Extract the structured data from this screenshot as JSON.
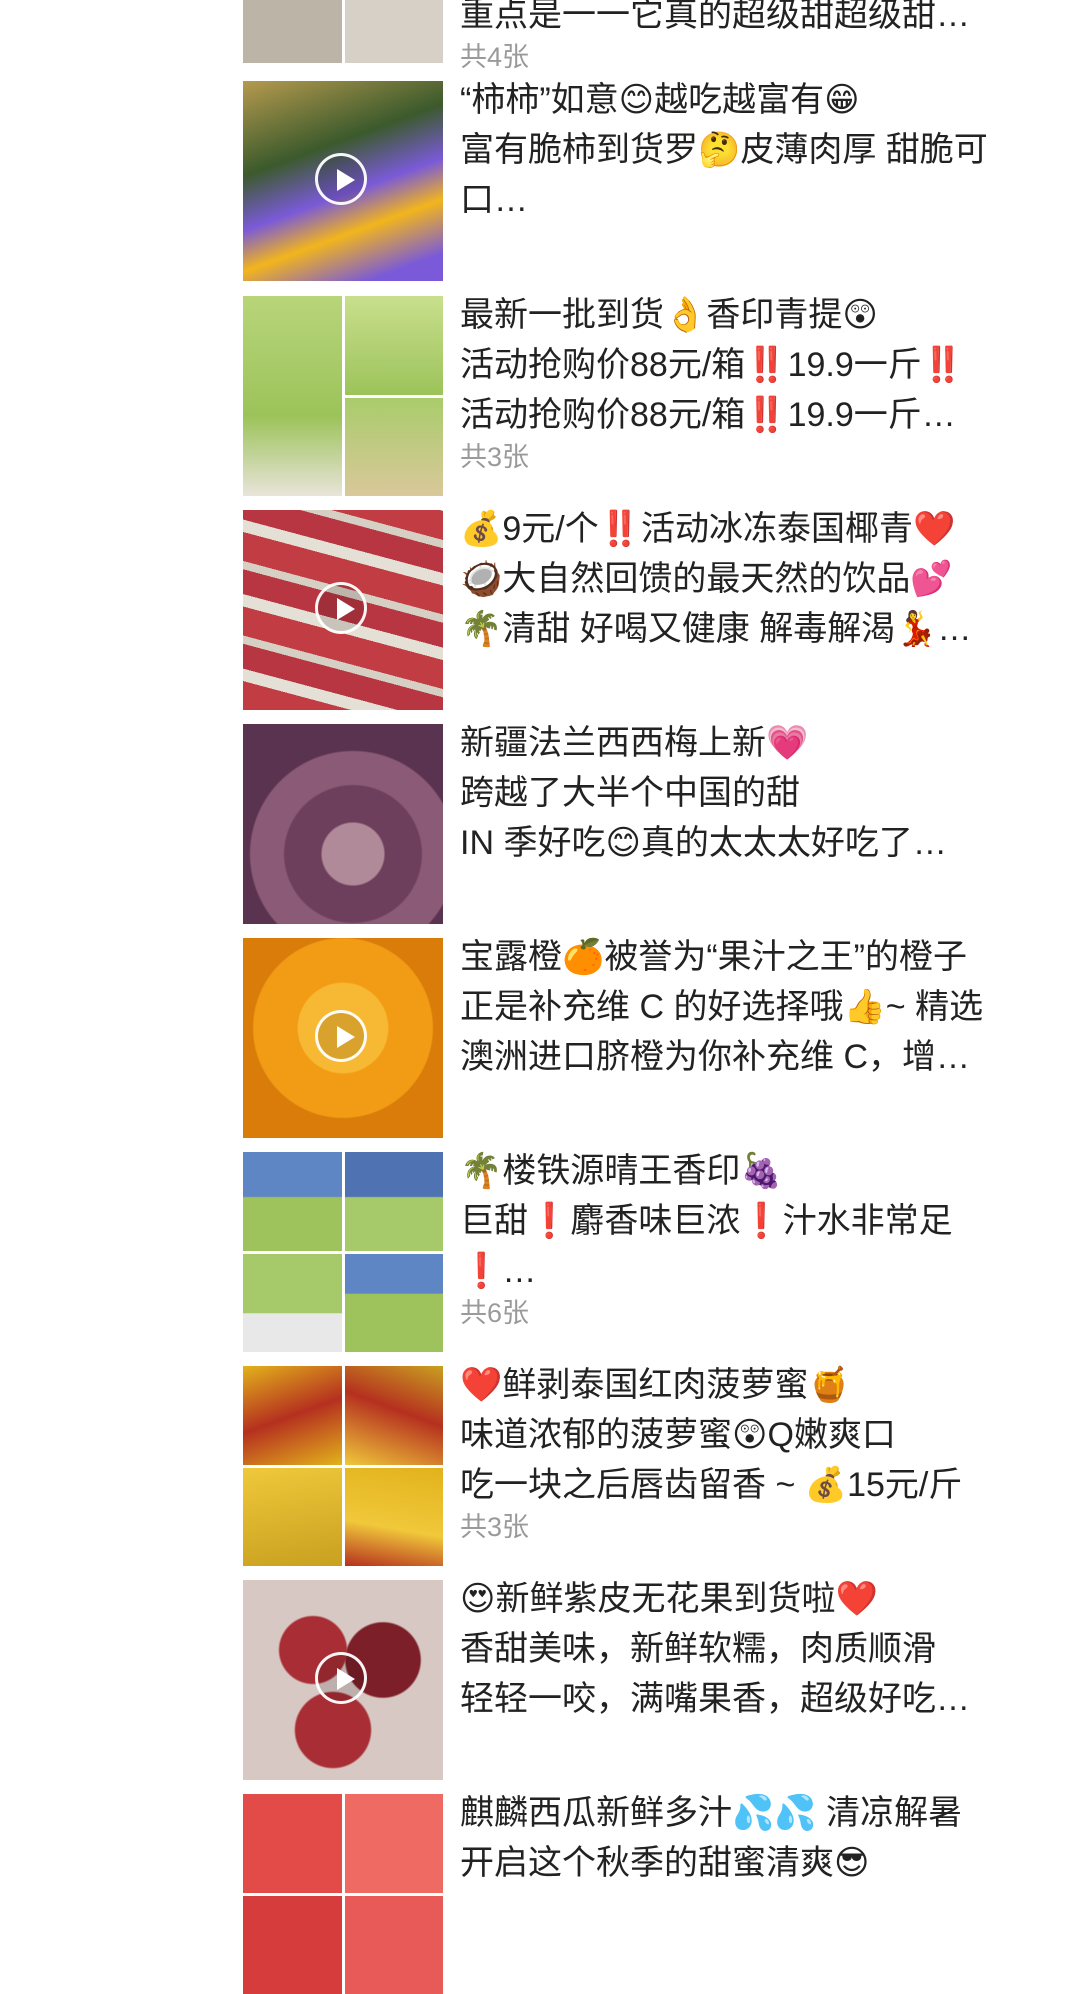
{
  "posts": [
    {
      "lines": [
        "重点是一一它真的超级甜超级甜…"
      ],
      "count": "共4张",
      "thumb_colors": [
        "#cfc7bd",
        "#e4ded6",
        "#bdb4a8",
        "#d7d0c6"
      ]
    },
    {
      "lines": [
        "“柿柿”如意😊越吃越富有😁",
        "富有脆柿到货罗🤔皮薄肉厚 甜脆可",
        "口…"
      ],
      "video": true,
      "thumb_colors": [
        "#b59a4e",
        "#f2b51c",
        "#7a5ad8"
      ]
    },
    {
      "lines": [
        "最新一批到货👌香印青提😲",
        "活动抢购价88元/箱‼️19.9一斤‼️",
        "活动抢购价88元/箱‼️19.9一斤…"
      ],
      "count": "共3张",
      "thumb_colors": [
        "#9cc35a",
        "#b8d57a",
        "#c9df8d"
      ]
    },
    {
      "lines": [
        "💰9元/个‼️活动冰冻泰国椰青❤️",
        "🥥大自然回馈的最天然的饮品💕",
        "🌴清甜 好喝又健康 解毒解渴💃…"
      ],
      "video": true,
      "thumb_colors": [
        "#c23c44",
        "#e4e0d6",
        "#b73641"
      ]
    },
    {
      "lines": [
        "新疆法兰西西梅上新💗",
        "跨越了大半个中国的甜",
        "IN 季好吃😊真的太太太好吃了…"
      ],
      "thumb_colors": [
        "#6e3f5c",
        "#8b5a76",
        "#b08a98"
      ]
    },
    {
      "lines": [
        "宝露橙🍊被誉为“果汁之王”的橙子",
        "正是补充维 C 的好选择哦👍~ 精选",
        "澳洲进口脐橙为你补充维 C，增…"
      ],
      "video": true,
      "thumb_colors": [
        "#f29b14",
        "#f7b934",
        "#d97c0a"
      ]
    },
    {
      "lines": [
        "🌴楼铁源晴王香印🍇",
        "巨甜❗麝香味巨浓❗汁水非常足",
        "❗…"
      ],
      "count": "共6张",
      "thumb_colors": [
        "#5f86c4",
        "#9ec25c",
        "#4f73b2",
        "#a6c96a"
      ]
    },
    {
      "lines": [
        "❤️鲜剥泰国红肉菠萝蜜🍯",
        "味道浓郁的菠萝蜜😲Q嫩爽口",
        "吃一块之后唇齿留香 ~ 💰15元/斤"
      ],
      "count": "共3张",
      "thumb_colors": [
        "#e2b21c",
        "#c9a020",
        "#f0c83a",
        "#b5301f"
      ]
    },
    {
      "lines": [
        "😍新鲜紫皮无花果到货啦❤️",
        "香甜美味，新鲜软糯，肉质顺滑",
        "轻轻一咬，满嘴果香，超级好吃…"
      ],
      "video": true,
      "thumb_colors": [
        "#a82d35",
        "#d8c8c4",
        "#7c1f28"
      ]
    },
    {
      "lines": [
        "麒麟西瓜新鲜多汁💦💦 清凉解暑",
        "开启这个秋季的甜蜜清爽😎"
      ],
      "thumb_colors": [
        "#e24b48",
        "#f06a64",
        "#d63c3c",
        "#e85a58"
      ]
    }
  ]
}
